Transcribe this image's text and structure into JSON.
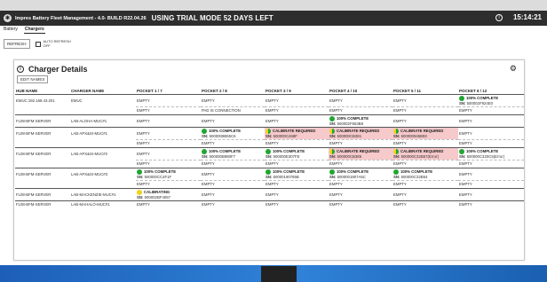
{
  "titlebar": {
    "app_icon": "✱",
    "app_title": "Impres Battery Fleet Management - 4.0- BUILD R22.04.26",
    "trial": "USING TRIAL MODE 52 DAYS LEFT",
    "info_icon": "i",
    "clock": "15:14:21"
  },
  "tabs": [
    {
      "label": "Battery"
    },
    {
      "label": "Chargers"
    }
  ],
  "controls": {
    "refresh": "REFRESH",
    "auto_refresh_line1": "AUTO REFRESH",
    "auto_refresh_line2": "OFF"
  },
  "panel": {
    "title": "Charger Details",
    "info_icon": "i",
    "gear_icon": "⚙",
    "edit_names": "EDIT NAMES"
  },
  "columns": [
    "HUB NAME",
    "CHARGER NAME",
    "POCKET 1 / 7",
    "POCKET 2 / 8",
    "POCKET 3 / 9",
    "POCKET 4 / 10",
    "POCKET 5 / 11",
    "POCKET 6 / 12"
  ],
  "groups": [
    {
      "hub": "EMUC:192.168.43.201",
      "charger": "EMUC",
      "row1": [
        {
          "status": "EMPTY"
        },
        {
          "status": "EMPTY"
        },
        {
          "status": "EMPTY"
        },
        {
          "status": "EMPTY"
        },
        {
          "status": "EMPTY"
        },
        {
          "status": "100% COMPLETE",
          "dot": "green",
          "sn": "500002F924E0"
        }
      ],
      "row2": [
        {
          "status": "EMPTY"
        },
        {
          "status": "PAD IS CONNECTION"
        },
        {
          "status": "EMPTY"
        },
        {
          "status": "EMPTY"
        },
        {
          "status": "EMPTY"
        },
        {
          "status": "EMPTY"
        }
      ]
    },
    {
      "hub": "FL08-BFM-SERVER",
      "charger": "LAB-ALOHA-MUC#1",
      "row1": [
        {
          "status": "EMPTY"
        },
        {
          "status": "EMPTY"
        },
        {
          "status": "EMPTY"
        },
        {
          "status": "100% COMPLETE",
          "dot": "green",
          "sn": "500002F653B8"
        },
        {
          "status": "EMPTY"
        },
        {
          "status": "EMPTY"
        }
      ]
    },
    {
      "hub": "FL08-BFM-SERVER",
      "charger": "LAB-APX&SI-MUC#1",
      "row1": [
        {
          "status": "EMPTY"
        },
        {
          "status": "100% COMPLETE",
          "dot": "green",
          "sn": "5000008B55C6"
        },
        {
          "status": "CALIBRATE REQUIRED",
          "dot": "split",
          "sn": "500000C468F",
          "calib": true
        },
        {
          "status": "CALIBRATE REQUIRED",
          "dot": "split",
          "sn": "500000CB381",
          "calib": true
        },
        {
          "status": "CALIBRATE REQUIRED",
          "dot": "split",
          "sn": "500000945B93",
          "calib": true
        },
        {
          "status": "EMPTY"
        }
      ],
      "row2": [
        {
          "status": "EMPTY"
        },
        {
          "status": "EMPTY"
        },
        {
          "status": "EMPTY"
        },
        {
          "status": "EMPTY"
        },
        {
          "status": "EMPTY"
        },
        {
          "status": "EMPTY"
        }
      ]
    },
    {
      "hub": "FL08-BFM-SERVER",
      "charger": "LAB-APX&SI-MUC#2",
      "row1": [
        {
          "status": "EMPTY"
        },
        {
          "status": "100% COMPLETE",
          "dot": "green",
          "sn": "500000B980F7"
        },
        {
          "status": "100% COMPLETE",
          "dot": "green",
          "sn": "500000E307FE"
        },
        {
          "status": "CALIBRATE REQUIRED",
          "dot": "split",
          "sn": "500000CB385",
          "calib": true
        },
        {
          "status": "CALIBRATE REQUIRED",
          "dot": "split",
          "sn": "500000C32B57(Error)",
          "calib": true
        },
        {
          "status": "100% COMPLETE",
          "dot": "green",
          "sn": "500000C320C5(Error)"
        }
      ],
      "row2": [
        {
          "status": "EMPTY"
        },
        {
          "status": "EMPTY"
        },
        {
          "status": "EMPTY"
        },
        {
          "status": "EMPTY"
        },
        {
          "status": "EMPTY"
        },
        {
          "status": "EMPTY"
        }
      ]
    },
    {
      "hub": "FL08-BFM-SERVER",
      "charger": "LAB-APX&SI-MUC#3",
      "row1": [
        {
          "status": "100% COMPLETE",
          "dot": "green",
          "sn": "500000CC4F1F"
        },
        {
          "status": "EMPTY"
        },
        {
          "status": "100% COMPLETE",
          "dot": "green",
          "sn": "50000190785B"
        },
        {
          "status": "100% COMPLETE",
          "dot": "green",
          "sn": "5000001807A5C"
        },
        {
          "status": "100% COMPLETE",
          "dot": "green",
          "sn": "500000C32B54"
        },
        {
          "status": "EMPTY"
        }
      ],
      "row2": [
        {
          "status": "EMPTY"
        },
        {
          "status": "EMPTY"
        },
        {
          "status": "EMPTY"
        },
        {
          "status": "EMPTY"
        },
        {
          "status": "EMPTY"
        },
        {
          "status": "EMPTY"
        }
      ]
    },
    {
      "hub": "FL08-BFM-SERVER",
      "charger": "LAB-MACKENZIE-MUC#1",
      "row1": [
        {
          "status": "CALIBRATING",
          "dot": "yellow",
          "sn": "500002BF4057"
        },
        {
          "status": "EMPTY"
        },
        {
          "status": "EMPTY"
        },
        {
          "status": "EMPTY"
        },
        {
          "status": "EMPTY"
        },
        {
          "status": "EMPTY"
        }
      ]
    },
    {
      "hub": "FL08-BFM-SERVER",
      "charger": "LAB-MAHALO-MUC#1",
      "row1": [
        {
          "status": "EMPTY"
        },
        {
          "status": "EMPTY"
        },
        {
          "status": "EMPTY"
        },
        {
          "status": "EMPTY"
        },
        {
          "status": "EMPTY"
        },
        {
          "status": "EMPTY"
        }
      ]
    }
  ],
  "labels": {
    "sn_prefix": "SN:"
  },
  "colors": {
    "complete": "#22a533",
    "calibrating": "#f0d21a",
    "calibrate_required_bg": "#f6c9cb",
    "titlebar": "#2e2e2e"
  }
}
